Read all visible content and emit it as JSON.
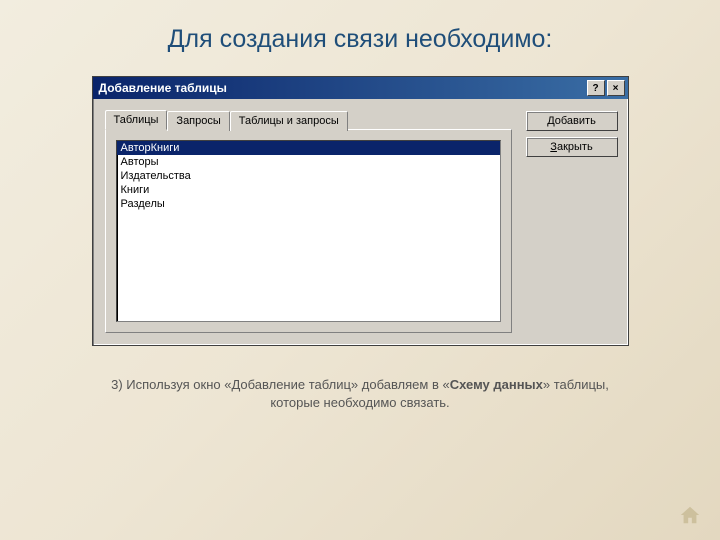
{
  "slide": {
    "title": "Для создания связи необходимо:",
    "caption_prefix": "3) Используя окно «Добавление таблиц» добавляем в «",
    "caption_bold": "Схему данных",
    "caption_suffix": "» таблицы, которые необходимо связать."
  },
  "dialog": {
    "title": "Добавление таблицы",
    "help_symbol": "?",
    "close_symbol": "×",
    "tabs": [
      {
        "label": "Таблицы",
        "active": true
      },
      {
        "label": "Запросы",
        "active": false
      },
      {
        "label": "Таблицы и запросы",
        "active": false
      }
    ],
    "list_items": [
      {
        "text": "АвторКниги",
        "selected": true
      },
      {
        "text": "Авторы",
        "selected": false
      },
      {
        "text": "Издательства",
        "selected": false
      },
      {
        "text": "Книги",
        "selected": false
      },
      {
        "text": "Разделы",
        "selected": false
      }
    ],
    "buttons": {
      "add_ul": "Д",
      "add_rest": "обавить",
      "close_ul": "З",
      "close_rest": "акрыть"
    }
  },
  "nav": {
    "home_icon": "home-icon"
  }
}
